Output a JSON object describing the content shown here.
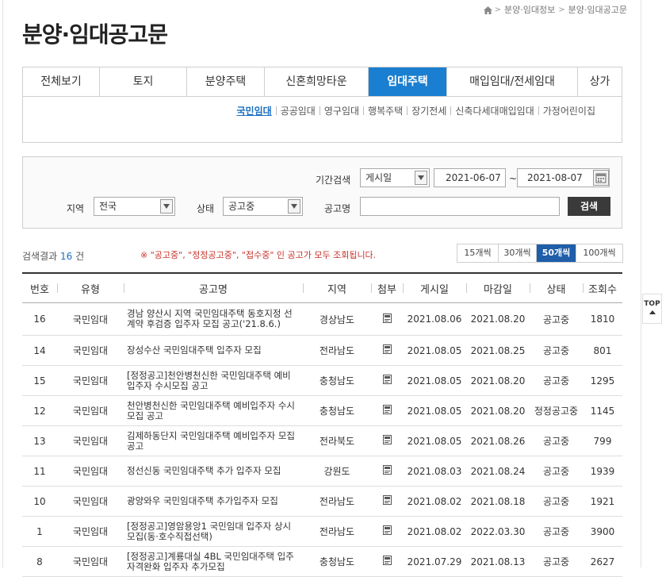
{
  "breadcrumb": [
    "분양·임대정보",
    "분양·임대공고문"
  ],
  "page_title": "분양·임대공고문",
  "tabs": [
    "전체보기",
    "토지",
    "분양주택",
    "신혼희망타운",
    "임대주택",
    "매입임대/전세임대",
    "상가"
  ],
  "active_tab": "임대주택",
  "subnav": [
    "국민임대",
    "공공임대",
    "영구임대",
    "행복주택",
    "장기전세",
    "신축다세대매입임대",
    "가정어린이집"
  ],
  "active_subnav": "국민임대",
  "search": {
    "period_label": "기간검색",
    "period_type": "게시일",
    "date_from": "2021-06-07",
    "date_sep": "~",
    "date_to": "2021-08-07",
    "region_label": "지역",
    "region_value": "전국",
    "status_label": "상태",
    "status_value": "공고중",
    "title_label": "공고명",
    "title_value": "",
    "button": "검색"
  },
  "result": {
    "prefix": "검색결과",
    "count": "16",
    "suffix": "건"
  },
  "notice": "※ \"공고중\", \"정정공고중\", \"접수중\" 인 공고가 모두 조회됩니다.",
  "page_sizes": [
    "15개씩",
    "30개씩",
    "50개씩",
    "100개씩"
  ],
  "active_page_size": "50개씩",
  "table": {
    "headers": [
      "번호",
      "유형",
      "공고명",
      "지역",
      "첨부",
      "게시일",
      "마감일",
      "상태",
      "조회수"
    ],
    "rows": [
      [
        "16",
        "국민임대",
        "경남 양산시 지역 국민임대주택 동호지정 선계약 후검증 입주자 모집 공고('21.8.6.)",
        "경상남도",
        "2021.08.06",
        "2021.08.20",
        "공고중",
        "1810"
      ],
      [
        "14",
        "국민임대",
        "장성수산 국민임대주택 입주자 모집",
        "전라남도",
        "2021.08.05",
        "2021.08.25",
        "공고중",
        "801"
      ],
      [
        "15",
        "국민임대",
        "[정정공고]천안병천신한 국민임대주택 예비입주자 수시모집 공고",
        "충청남도",
        "2021.08.05",
        "2021.08.20",
        "공고중",
        "1295"
      ],
      [
        "12",
        "국민임대",
        "천안병천신한 국민임대주택 예비입주자 수시모집 공고",
        "충청남도",
        "2021.08.05",
        "2021.08.20",
        "정정공고중",
        "1145"
      ],
      [
        "13",
        "국민임대",
        "김제하동단지 국민임대주택 예비입주자 모집 공고",
        "전라북도",
        "2021.08.05",
        "2021.08.26",
        "공고중",
        "799"
      ],
      [
        "11",
        "국민임대",
        "정선신동 국민임대주택 추가 입주자 모집",
        "강원도",
        "2021.08.03",
        "2021.08.24",
        "공고중",
        "1939"
      ],
      [
        "10",
        "국민임대",
        "광양와우 국민임대주택 추가입주자 모집",
        "전라남도",
        "2021.08.02",
        "2021.08.18",
        "공고중",
        "1921"
      ],
      [
        "1",
        "국민임대",
        "[정정공고]영암용앙1 국민임대 입주자 상시모집(동·호수직접선택)",
        "전라남도",
        "2021.08.02",
        "2022.03.30",
        "공고중",
        "3900"
      ],
      [
        "8",
        "국민임대",
        "[정정공고]계룡대실 4BL 국민임대주택 입주자격완화 입주자 추가모집",
        "충청남도",
        "2021.07.29",
        "2021.08.13",
        "공고중",
        "2627"
      ]
    ]
  },
  "top_button": "TOP",
  "icons": {
    "home": "home-icon",
    "calendar": "calendar-icon",
    "attachment": "document-icon",
    "top": "arrow-up-icon"
  }
}
